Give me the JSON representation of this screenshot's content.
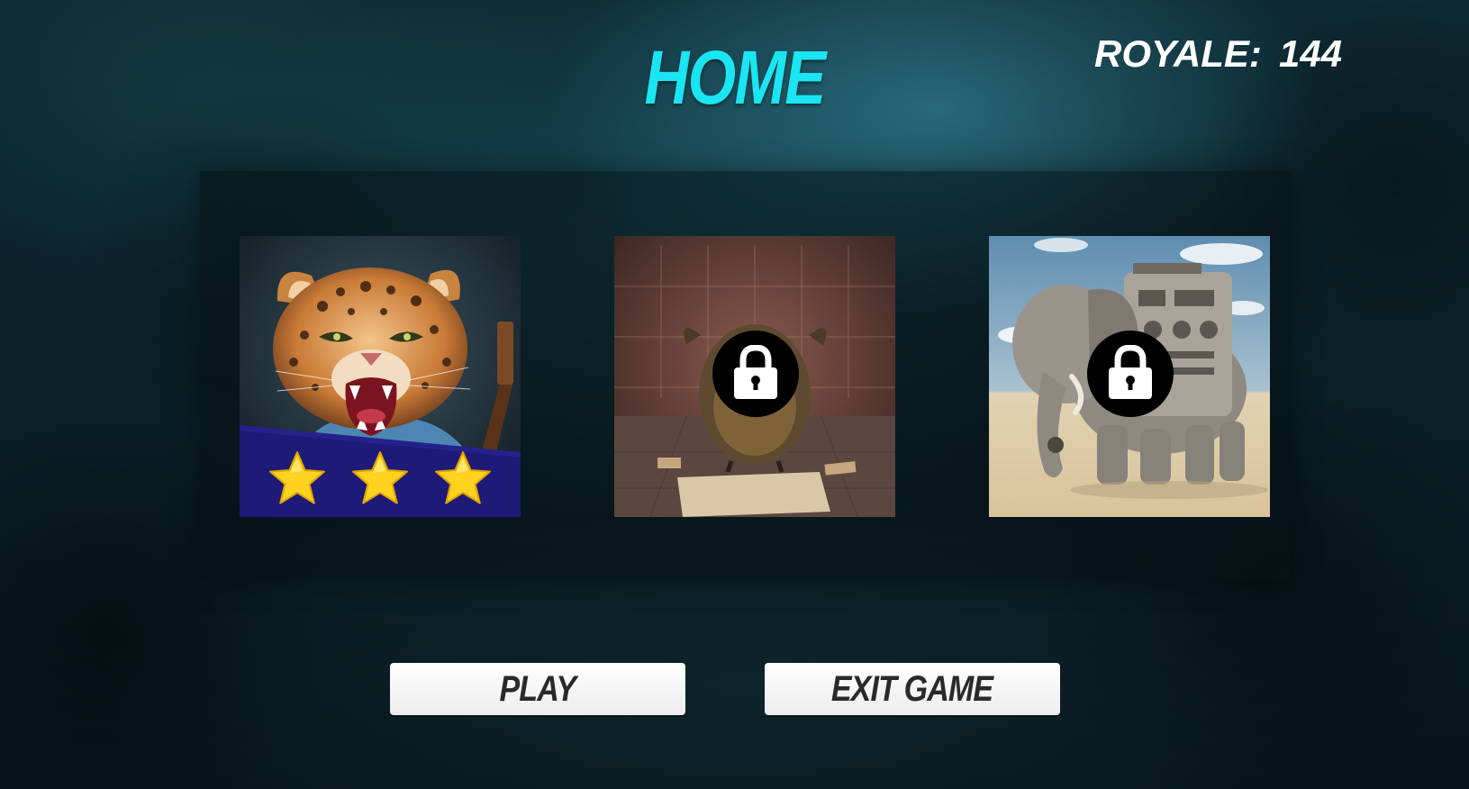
{
  "screen": {
    "title": "HOME"
  },
  "score": {
    "label": "ROYALE:",
    "value": "144"
  },
  "levels": [
    {
      "icon": "leopard-guitarist-image",
      "locked": false,
      "stars": 3
    },
    {
      "icon": "owl-monster-chalkboard-image",
      "locked": true,
      "stars": 0
    },
    {
      "icon": "robot-elephant-desert-image",
      "locked": true,
      "stars": 0
    }
  ],
  "buttons": {
    "play_label": "PLAY",
    "exit_label": "EXIT GAME"
  },
  "colors": {
    "title": "#19e6f2",
    "star": "#ffd21f",
    "star_band": "#1d1a78",
    "button_bg": "#ffffff",
    "button_text": "#2a2a2a"
  }
}
